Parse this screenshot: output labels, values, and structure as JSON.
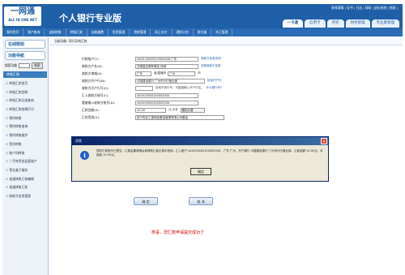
{
  "header": {
    "logo_cn": "一网通",
    "logo_en": "ALL IN ONE NET",
    "title": "个人银行专业版",
    "toplinks": "联系客服 | 证书 | 日志 | 帮助 | 退出系统 | 锁屏 |",
    "tabs": [
      {
        "label": "一卡通",
        "active": true
      },
      {
        "label": "信用卡",
        "active": false
      },
      {
        "label": "存折",
        "active": false
      },
      {
        "label": "财务管理",
        "active": false
      },
      {
        "label": "专业版管理",
        "active": false
      }
    ]
  },
  "navbar": [
    "我的首页",
    "账户查询",
    "自助转账",
    "转账汇款",
    "自助缴费",
    "投资管理",
    "贷款管理",
    "网上支付",
    "理财计划",
    "财付通",
    "外汇管理"
  ],
  "sidebar": {
    "online_help": "在线帮助",
    "function_nav": "功能导航",
    "search_label": "搜索功能",
    "search_button": "搜索",
    "section": "转账汇款",
    "items": [
      "转账汇款首页",
      "转账汇款定制",
      "转账汇款记录查询",
      "转账汇款结果打印",
      "预约转账",
      "预约转账查询",
      "预约转账维护",
      "签约转账",
      "账户间转账",
      "二手房资金监管账户",
      "营业盒子服务",
      "批量转账汇款编辑",
      "批量转账汇款",
      "收款方信息管理"
    ]
  },
  "main": {
    "breadcrumb": "当前功能: 同行异地汇款",
    "form": {
      "payer_label": "付款账户(T):",
      "payer_value": "4400.15633010550026 广东",
      "payer_note": "收款方信息查询",
      "payee_name_label": "收款方户名(N):",
      "payee_name_value": "去哪直至哪有哪至 西域",
      "payee_name_note": "查看收款方信息",
      "payee_region_label": "收款方地域(A):",
      "payee_region_value": "广东",
      "payee_city_label": "省/直辖市",
      "payee_city_value": "广州",
      "payee_city_suffix": "市",
      "payee_bank_label": "收款方开户行(B):",
      "payee_bank_value": "中国建设银行 广州市分行营业部",
      "payee_bank_note": "检索开户行",
      "bank_no_label": "收款方开户行号(G):",
      "bank_no_hint": "检索不到行号，可直接输入开户行名。",
      "bank_no_link": "什么是行号?",
      "account_label": "汇入收款方账号(C):",
      "account_value": "440015800100002000",
      "account_confirm_label": "重复输入收款方账号(D):",
      "account_confirm_value": "440015800100002000",
      "amount_label": "汇款金额(E):",
      "amount_value": "10.00",
      "amount_note": "元  大写",
      "amount_words": "壹拾元整",
      "purpose_label": "汇款用途(U):",
      "purpose_value": "用于购买工银瑞信基金管理有限公司基金",
      "confirm_button": "确 定",
      "cancel_button": "取 消"
    },
    "success_message": "恭喜，您汇款申请提交成功了"
  },
  "dialog": {
    "title": "消息",
    "icon": "info-icon",
    "message": "您的汇款指令已提交，汇款结果请稍后到转账汇款记录中查询。汇入账户 440015800100002000，广东 广州，开户银行 中国建设银行 广州市分行营业部，汇款金额 10.00元，手续费 10.00元。",
    "ok_button": "确定"
  },
  "colors": {
    "brand": "#1f5fa8",
    "nav": "#2a6bb5",
    "success": "#cc0000",
    "dialog_bg": "#ece9d8"
  }
}
